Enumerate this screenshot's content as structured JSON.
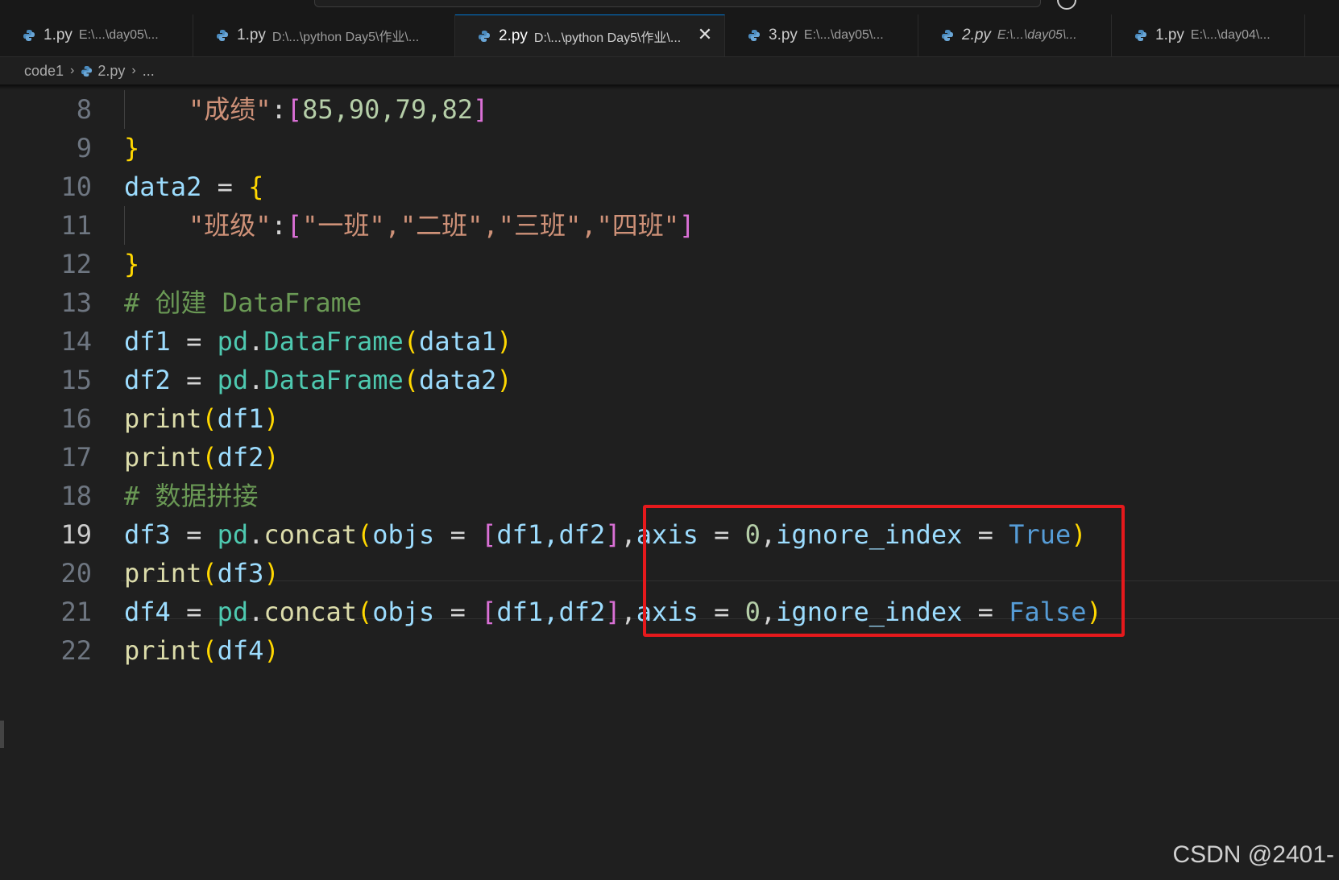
{
  "tabs": [
    {
      "name": "1.py",
      "path": "E:\\...\\day05\\...",
      "active": false,
      "italic": false
    },
    {
      "name": "1.py",
      "path": "D:\\...\\python Day5\\作业\\...",
      "active": false,
      "italic": false
    },
    {
      "name": "2.py",
      "path": "D:\\...\\python Day5\\作业\\...",
      "active": true,
      "italic": false
    },
    {
      "name": "3.py",
      "path": "E:\\...\\day05\\...",
      "active": false,
      "italic": false
    },
    {
      "name": "2.py",
      "path": "E:\\...\\day05\\...",
      "active": false,
      "italic": true
    },
    {
      "name": "1.py",
      "path": "E:\\...\\day04\\...",
      "active": false,
      "italic": false
    }
  ],
  "close_glyph": "✕",
  "breadcrumb": {
    "folder": "code1",
    "file": "2.py",
    "more": "...",
    "separator": "›"
  },
  "line_numbers": [
    "8",
    "9",
    "10",
    "11",
    "12",
    "13",
    "14",
    "15",
    "16",
    "17",
    "18",
    "19",
    "20",
    "21",
    "22"
  ],
  "code": {
    "l8": {
      "key": "\"成绩\"",
      "colon": ":",
      "open": "[",
      "values": "85,90,79,82",
      "close": "]"
    },
    "l9": {
      "brace": "}"
    },
    "l10": {
      "name": "data2",
      "eq": " = ",
      "brace": "{"
    },
    "l11": {
      "key": "\"班级\"",
      "colon": ":",
      "open": "[",
      "items": "\"一班\",\"二班\",\"三班\",\"四班\"",
      "close": "]"
    },
    "l12": {
      "brace": "}"
    },
    "l13": {
      "comment": "# 创建 DataFrame"
    },
    "l14": {
      "var": "df1",
      "eq": " = ",
      "mod": "pd",
      "dot": ".",
      "cls": "DataFrame",
      "open": "(",
      "arg": "data1",
      "close": ")"
    },
    "l15": {
      "var": "df2",
      "eq": " = ",
      "mod": "pd",
      "dot": ".",
      "cls": "DataFrame",
      "open": "(",
      "arg": "data2",
      "close": ")"
    },
    "l16": {
      "fn": "print",
      "open": "(",
      "arg": "df1",
      "close": ")"
    },
    "l17": {
      "fn": "print",
      "open": "(",
      "arg": "df2",
      "close": ")"
    },
    "l18": {
      "comment": "# 数据拼接"
    },
    "l19": {
      "var": "df3",
      "eq": " = ",
      "mod": "pd",
      "dot": ".",
      "fn": "concat",
      "open": "(",
      "p1": "objs",
      "eq2": " = ",
      "lopen": "[",
      "list": "df1,df2",
      "lclose": "]",
      "comma": ",",
      "p2": "axis",
      "eq3": " = ",
      "n": "0",
      "comma2": ",",
      "p3": "ignore_index",
      "eq4": " = ",
      "kw": "True",
      "close": ")"
    },
    "l20": {
      "fn": "print",
      "open": "(",
      "arg": "df3",
      "close": ")"
    },
    "l21": {
      "var": "df4",
      "eq": " = ",
      "mod": "pd",
      "dot": ".",
      "fn": "concat",
      "open": "(",
      "p1": "objs",
      "eq2": " = ",
      "lopen": "[",
      "list": "df1,df2",
      "lclose": "]",
      "comma": ",",
      "p2": "axis",
      "eq3": " = ",
      "n": "0",
      "comma2": ",",
      "p3": "ignore_index",
      "eq4": " = ",
      "kw": "False",
      "close": ")"
    },
    "l22": {
      "fn": "print",
      "open": "(",
      "arg": "df4",
      "close": ")"
    }
  },
  "current_line": "19",
  "watermark": "CSDN @2401-",
  "colors": {
    "background": "#1f1f1f",
    "highlight_box": "#e5191c",
    "active_tab_accent": "#0078d4"
  }
}
